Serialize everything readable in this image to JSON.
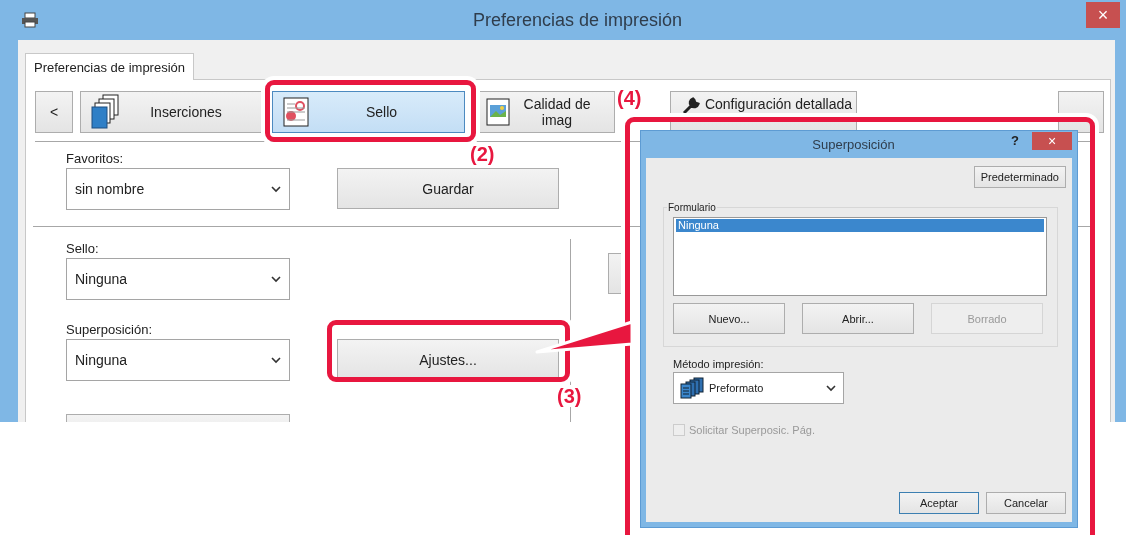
{
  "window": {
    "title": "Preferencias de impresión",
    "close": "×"
  },
  "tabs": [
    {
      "label": "Preferencias de impresión",
      "selected": true
    }
  ],
  "categories": {
    "prev": "<",
    "items": [
      {
        "label": "Inserciones",
        "kind": "pages",
        "selected": false
      },
      {
        "label": "Sello",
        "kind": "stamp",
        "selected": true
      },
      {
        "label": "Calidad de imag",
        "kind": "image",
        "selected": false
      },
      {
        "label": "Configuración detallada",
        "kind": "wrench",
        "selected": false
      }
    ]
  },
  "favorites": {
    "label": "Favoritos:",
    "value": "sin nombre",
    "button": "Guardar"
  },
  "stamp": {
    "label": "Sello:",
    "value": "Ninguna"
  },
  "overlay": {
    "label": "Superposición:",
    "value": "Ninguna",
    "button": "Ajustes..."
  },
  "callouts": [
    {
      "label": "(2)"
    },
    {
      "label": "(3)"
    },
    {
      "label": "(4)"
    }
  ],
  "dialog": {
    "title": "Superposición",
    "help": "?",
    "close": "×",
    "default_button": "Predeterminado",
    "group_label": "Formulario",
    "forms": [
      {
        "label": "Ninguna",
        "selected": true
      }
    ],
    "buttons": [
      {
        "label": "Nuevo...",
        "disabled": false
      },
      {
        "label": "Abrir...",
        "disabled": false
      },
      {
        "label": "Borrado",
        "disabled": true
      }
    ],
    "method": {
      "label": "Método impresión:",
      "value": "Preformato"
    },
    "checkbox": {
      "label": "Solicitar Superposic. Pág.",
      "checked": false,
      "disabled": true
    },
    "footer_buttons": [
      {
        "label": "Aceptar",
        "focused": true
      },
      {
        "label": "Cancelar",
        "focused": false
      }
    ]
  }
}
